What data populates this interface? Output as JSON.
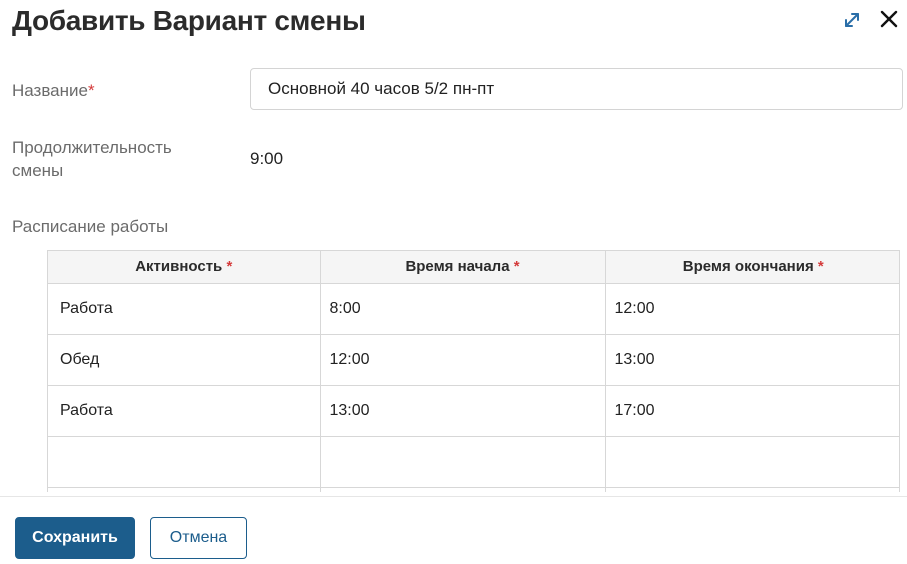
{
  "dialog": {
    "title": "Добавить Вариант смены"
  },
  "icons": {
    "expand": "expand-diagonal-arrows-icon",
    "close": "close-x-icon"
  },
  "colors": {
    "primary": "#1c5d8c",
    "required": "#d43a3a",
    "expand_icon": "#2a6ea8"
  },
  "form": {
    "name_label": "Название",
    "name_required": "*",
    "name_value": "Основной 40 часов 5/2 пн-пт",
    "duration_label": "Продолжительность смены",
    "duration_value": "9:00",
    "schedule_label": "Расписание работы"
  },
  "table": {
    "headers": [
      {
        "label": "Активность",
        "required": "*"
      },
      {
        "label": "Время начала",
        "required": "*"
      },
      {
        "label": "Время окончания",
        "required": "*"
      }
    ],
    "rows": [
      {
        "activity": "Работа",
        "start": "8:00",
        "end": "12:00"
      },
      {
        "activity": "Обед",
        "start": "12:00",
        "end": "13:00"
      },
      {
        "activity": "Работа",
        "start": "13:00",
        "end": "17:00"
      },
      {
        "activity": "",
        "start": "",
        "end": ""
      },
      {
        "activity": "",
        "start": "",
        "end": ""
      }
    ]
  },
  "footer": {
    "save_label": "Сохранить",
    "cancel_label": "Отмена"
  }
}
